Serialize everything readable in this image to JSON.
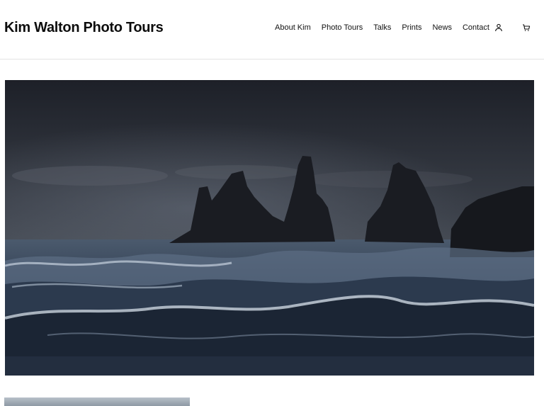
{
  "header": {
    "site_title": "Kim Walton Photo Tours",
    "nav": [
      {
        "label": "About Kim"
      },
      {
        "label": "Photo Tours"
      },
      {
        "label": "Talks"
      },
      {
        "label": "Prints"
      },
      {
        "label": "News"
      },
      {
        "label": "Contact"
      }
    ],
    "icons": {
      "account": "user-icon",
      "cart": "cart-icon"
    }
  },
  "hero": {
    "subject": "sea-stacks-waves-photo"
  },
  "colors": {
    "text": "#111111",
    "header_border": "#e3e3e3",
    "sky": "#2b2f38",
    "sea": "#3b4a5e"
  }
}
